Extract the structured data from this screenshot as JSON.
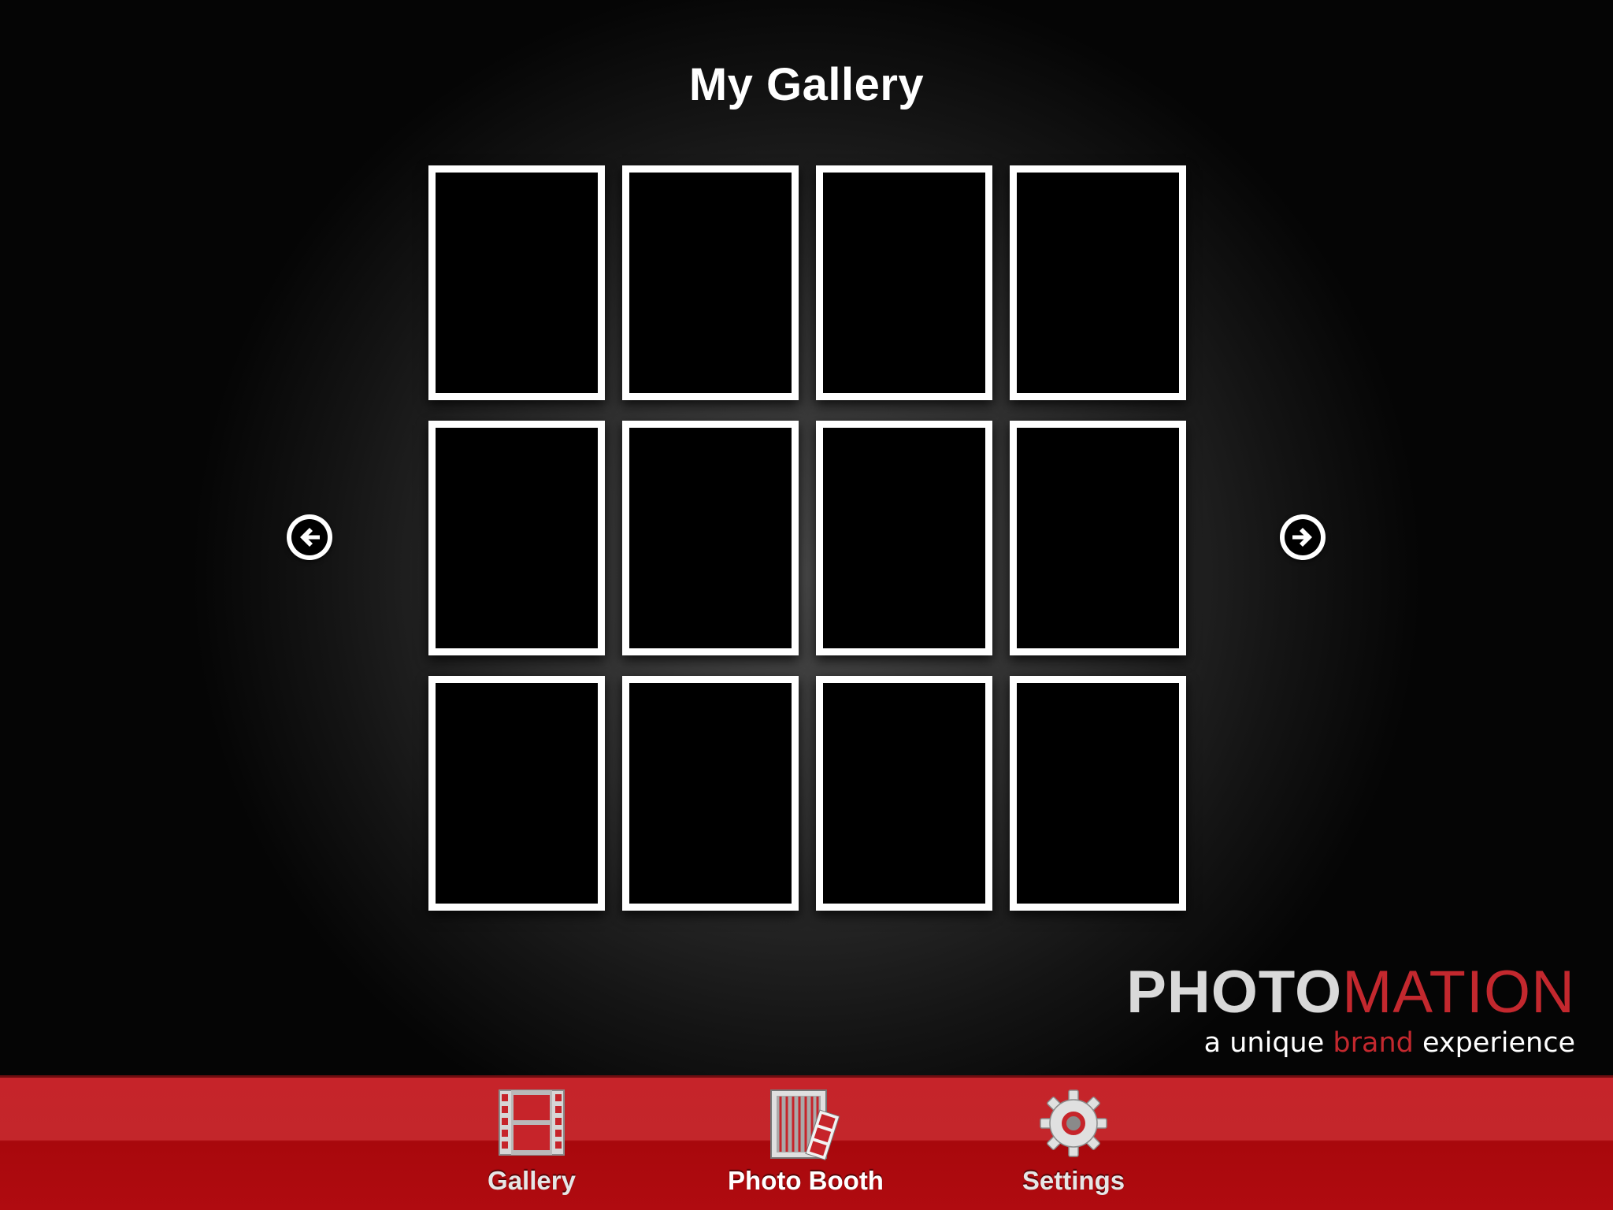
{
  "page": {
    "title": "My Gallery"
  },
  "gallery": {
    "thumbnails": [
      {
        "label": ""
      },
      {
        "label": ""
      },
      {
        "label": ""
      },
      {
        "label": ""
      },
      {
        "label": ""
      },
      {
        "label": ""
      },
      {
        "label": ""
      },
      {
        "label": ""
      },
      {
        "label": ""
      },
      {
        "label": ""
      },
      {
        "label": ""
      },
      {
        "label": ""
      }
    ],
    "prev_icon": "arrow-left-icon",
    "next_icon": "arrow-right-icon"
  },
  "brand": {
    "name_part1": "PHOTO",
    "name_part2": "MATION",
    "tagline_part1": "a unique ",
    "tagline_accent": "brand",
    "tagline_part2": " experience",
    "accent_color": "#c3282e"
  },
  "tabbar": {
    "color": "#c3262b",
    "tabs": [
      {
        "label": "Gallery",
        "icon": "film-strip-icon",
        "active": false
      },
      {
        "label": "Photo Booth",
        "icon": "photo-booth-icon",
        "active": true
      },
      {
        "label": "Settings",
        "icon": "gear-icon",
        "active": false
      }
    ]
  }
}
